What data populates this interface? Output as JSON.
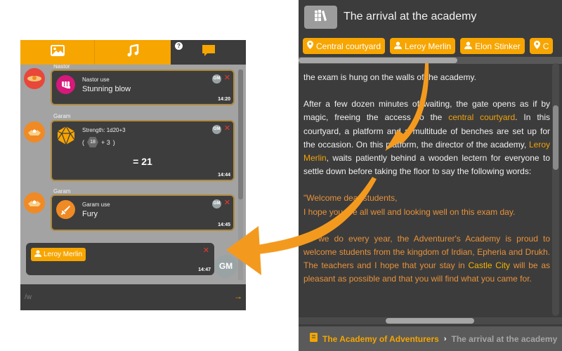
{
  "chat": {
    "tabs": [
      {
        "name": "images",
        "icon": "image-icon"
      },
      {
        "name": "music",
        "icon": "music-icon"
      },
      {
        "name": "chat",
        "icon": "chat-bubble-icon",
        "active": true,
        "help": "?"
      }
    ],
    "messages": [
      {
        "sender": "Nastor",
        "line1": "Nastor use",
        "line2": "Stunning blow",
        "gm": "GM",
        "close": "✕",
        "time": "14:20"
      },
      {
        "sender": "Garam",
        "line1": "Strength: 1d20+3",
        "dice_open": "(",
        "dice_value": "18",
        "dice_mod": "+ 3",
        "dice_close": ")",
        "total": "= 21",
        "gm": "GM",
        "close": "✕",
        "time": "14:44"
      },
      {
        "sender": "Garam",
        "line1": "Garam use",
        "line2": "Fury",
        "gm": "GM",
        "close": "✕",
        "time": "14:45"
      }
    ],
    "mention": {
      "label": "Leroy Merlin",
      "close": "✕",
      "time": "14:47",
      "avatar": "GM"
    },
    "input": {
      "value": "",
      "placeholder": "/w"
    }
  },
  "story": {
    "title": "The arrival at the academy",
    "tags": [
      {
        "type": "location",
        "label": "Central courtyard"
      },
      {
        "type": "character",
        "label": "Leroy Merlin"
      },
      {
        "type": "character",
        "label": "Elon Stinker"
      },
      {
        "type": "location",
        "label": "C"
      }
    ],
    "paragraphs": {
      "p1": "the exam is hung on the walls of the academy.",
      "p2a": "After a few dozen minutes of waiting, the gate opens as if by magic, freeing the access to the ",
      "p2_link1": "central courtyard",
      "p2b": ". In this courtyard, a platform and a multitude of benches are set up for the occasion. On this platform, the director of the academy, ",
      "p2_link2": "Leroy Merlin",
      "p2c": ", waits patiently behind a wooden lectern for everyone to settle down before taking the floor to say the following words:",
      "q1": "\"Welcome dear students,",
      "q2": "I hope you are all well and looking well on this exam day.",
      "q3a": "As we do every year, the Adventurer's Academy is proud to welcome students from the kingdom of Irdian, Epheria and Drukh. The teachers and I hope that your stay in ",
      "q3_link": "Castle City",
      "q3b": " will be as pleasant as possible and that you will find what you came for."
    },
    "breadcrumb": {
      "parent": "The Academy of Adventurers",
      "separator": "›",
      "current": "The arrival at the academy"
    }
  },
  "colors": {
    "accent": "#f7a500",
    "panel_dark": "#3c3c3c",
    "chat_bg": "#a3a3a3",
    "close_red": "#e83a2e",
    "arrow": "#f39a1e"
  }
}
